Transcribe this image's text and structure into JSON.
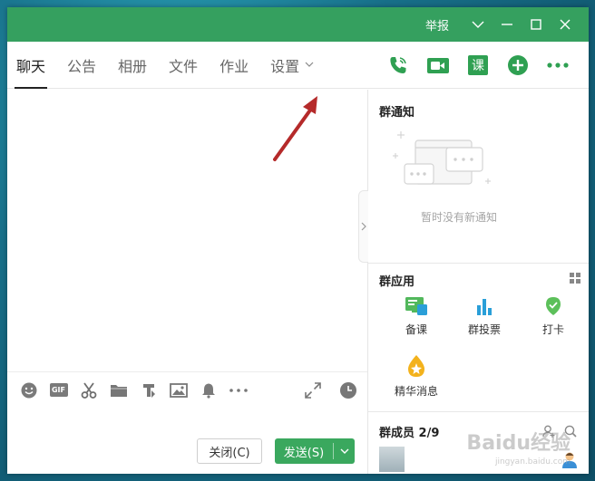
{
  "titlebar": {
    "report": "举报"
  },
  "tabs": [
    {
      "label": "聊天"
    },
    {
      "label": "公告"
    },
    {
      "label": "相册"
    },
    {
      "label": "文件"
    },
    {
      "label": "作业"
    },
    {
      "label": "设置"
    }
  ],
  "actions": {
    "course_label": "课"
  },
  "toolbar": {
    "gif_label": "GIF"
  },
  "buttons": {
    "close": "关闭(C)",
    "send": "发送(S)"
  },
  "notice": {
    "title": "群通知",
    "empty": "暂时没有新通知"
  },
  "apps": {
    "title": "群应用",
    "items": [
      {
        "label": "备课"
      },
      {
        "label": "群投票"
      },
      {
        "label": "打卡"
      },
      {
        "label": "精华消息"
      }
    ]
  },
  "members": {
    "title": "群成员 2/9"
  },
  "watermark": {
    "brand": "Baidu经验",
    "sub": "jingyan.baidu.com"
  },
  "colors": {
    "accent": "#35a05f",
    "annotation": "#b52a2a"
  }
}
